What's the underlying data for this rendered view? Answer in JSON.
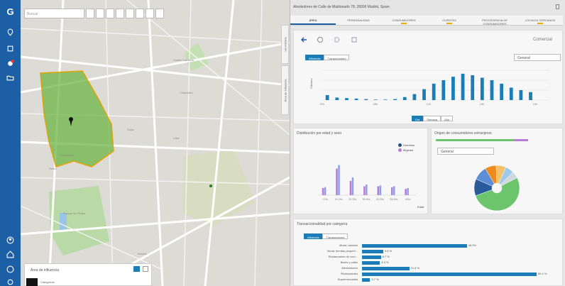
{
  "map": {
    "search_placeholder": "Buscar",
    "labels": [
      "Cuatro Caminos",
      "Chamberí",
      "Salamanca",
      "Retiro",
      "Parque del Retiro",
      "Goya",
      "Lista",
      "Atocha"
    ],
    "side_tabs": [
      "Ver informe",
      "Área de influencia"
    ],
    "infobox": {
      "title": "Área de influencia",
      "subtitle": "Categorías"
    }
  },
  "panel": {
    "address": "Alrededores de Calle de Maldonado 78, 28006 Madrid, Spain",
    "tabs": [
      {
        "label": "ÁREA",
        "active": true,
        "marker": false
      },
      {
        "label": "PERSONALIDAD",
        "active": false,
        "marker": false
      },
      {
        "label": "CONSUMIDORES",
        "active": false,
        "marker": true
      },
      {
        "label": "CLIENTES",
        "active": false,
        "marker": true
      },
      {
        "label": "PROCEDENCIA DE CONSUMIDORES",
        "active": false,
        "marker": false
      },
      {
        "label": "LOCALES CERCANOS",
        "active": false,
        "marker": true
      }
    ],
    "toolbar_right": "Comercial",
    "colors": {
      "accent": "#1a7db8",
      "purple": "#b57bd6",
      "green": "#6cc46c",
      "orange": "#f0a800"
    }
  },
  "chart1": {
    "seg_top": [
      "Afluencia",
      "Transacciones"
    ],
    "dropdown": "General",
    "seg_bottom": [
      "Día",
      "Semana",
      "Año"
    ],
    "seg_bottom_active": 0
  },
  "chart2": {
    "title": "Distribución por edad y sexo",
    "legend": [
      "Hombres",
      "Mujeres"
    ],
    "x_unit": "Edad"
  },
  "chart3": {
    "title": "Origen de consumidores extranjeros",
    "dropdown": "General"
  },
  "chart4": {
    "title": "Transaccionalidad por categoría",
    "seg": [
      "Afluencia",
      "Transacciones"
    ],
    "rows": [
      {
        "label": "Moda: calzado",
        "value_label": "48.3%"
      },
      {
        "label": "Moda: tiendas pequeñ...",
        "value_label": "9.8 %"
      },
      {
        "label": "Restaurantes de com...",
        "value_label": "8.7 %"
      },
      {
        "label": "Bares y cafés",
        "value_label": "8.3 %"
      },
      {
        "label": "Alimentación",
        "value_label": "21.8 %"
      },
      {
        "label": "Restaurantes",
        "value_label": "80.4 %"
      },
      {
        "label": "Supermercados",
        "value_label": "3.7 %"
      }
    ]
  },
  "chart_data": [
    {
      "type": "bar",
      "title": "",
      "ylabel": "Clientes",
      "x_ticks": [
        "00h",
        "06h",
        "12h",
        "18h",
        "24h"
      ],
      "values": [
        10,
        5,
        4,
        3,
        2,
        1,
        1,
        2,
        6,
        12,
        22,
        33,
        40,
        47,
        53,
        50,
        45,
        40,
        33,
        25,
        20,
        16
      ],
      "ylim": [
        0,
        60
      ]
    },
    {
      "type": "bar",
      "title": "Distribución por edad y sexo",
      "categories": [
        "<18a",
        "18-25a",
        "25-35a",
        "35-45a",
        "45-55a",
        "55-65a",
        ">65a"
      ],
      "series": [
        {
          "name": "Hombres",
          "values": [
            8,
            30,
            16,
            10,
            10,
            9,
            7
          ]
        },
        {
          "name": "Mujeres",
          "values": [
            9,
            34,
            20,
            12,
            11,
            10,
            8
          ]
        }
      ],
      "ylim": [
        0,
        40
      ]
    },
    {
      "type": "pie",
      "values": [
        52,
        12,
        10,
        8,
        7,
        6,
        5
      ]
    },
    {
      "type": "bar",
      "orientation": "horizontal",
      "categories": [
        "Moda: calzado",
        "Moda: tiendas pequeñ...",
        "Restaurantes de com...",
        "Bares y cafés",
        "Alimentación",
        "Restaurantes",
        "Supermercados"
      ],
      "values": [
        48.3,
        9.8,
        8.7,
        8.3,
        21.8,
        80.4,
        3.7
      ],
      "xlim": [
        0,
        85
      ]
    }
  ]
}
